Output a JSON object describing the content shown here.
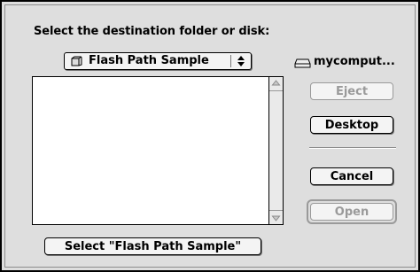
{
  "dialog": {
    "prompt": "Select the destination folder or disk:",
    "folder_popup": {
      "selected": "Flash Path Sample",
      "icon": "folder-icon"
    },
    "disk": {
      "name": "mycomput...",
      "icon": "disk-icon"
    },
    "file_list": {
      "items": []
    },
    "buttons": {
      "eject": "Eject",
      "desktop": "Desktop",
      "cancel": "Cancel",
      "open": "Open",
      "select": "Select \"Flash Path Sample\""
    },
    "disabled": [
      "eject",
      "open"
    ]
  }
}
